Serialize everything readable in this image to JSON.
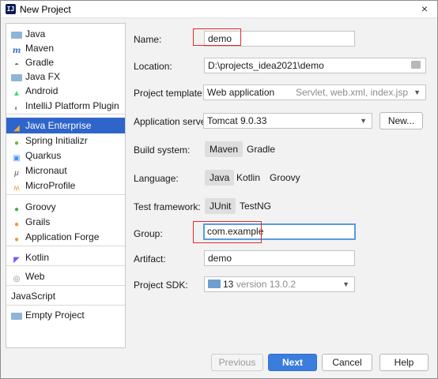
{
  "window": {
    "title": "New Project",
    "close_symbol": "×"
  },
  "sidebar": {
    "items": [
      {
        "label": "Java",
        "icon": "folder-icon"
      },
      {
        "label": "Maven",
        "icon": "maven-icon"
      },
      {
        "label": "Gradle",
        "icon": "gradle-icon"
      },
      {
        "label": "Java FX",
        "icon": "folder-icon"
      },
      {
        "label": "Android",
        "icon": "android-icon"
      },
      {
        "label": "IntelliJ Platform Plugin",
        "icon": "plugin-icon"
      },
      {
        "label": "Java Enterprise",
        "icon": "java-enterprise-icon"
      },
      {
        "label": "Spring Initializr",
        "icon": "spring-icon"
      },
      {
        "label": "Quarkus",
        "icon": "quarkus-icon"
      },
      {
        "label": "Micronaut",
        "icon": "micronaut-icon"
      },
      {
        "label": "MicroProfile",
        "icon": "microprofile-icon"
      },
      {
        "label": "Groovy",
        "icon": "groovy-icon"
      },
      {
        "label": "Grails",
        "icon": "grails-icon"
      },
      {
        "label": "Application Forge",
        "icon": "forge-icon"
      },
      {
        "label": "Kotlin",
        "icon": "kotlin-icon"
      },
      {
        "label": "Web",
        "icon": "web-icon"
      },
      {
        "label": "JavaScript",
        "icon": ""
      },
      {
        "label": "Empty Project",
        "icon": "folder-icon"
      }
    ],
    "selected": "Java Enterprise"
  },
  "form": {
    "name": {
      "label": "Name:",
      "value": "demo"
    },
    "location": {
      "label": "Location:",
      "value": "D:\\projects_idea2021\\demo"
    },
    "template": {
      "label": "Project template:",
      "value": "Web application",
      "hint": "Servlet, web.xml, index.jsp"
    },
    "server": {
      "label": "Application server:",
      "value": "Tomcat 9.0.33",
      "new_button": "New..."
    },
    "build": {
      "label": "Build system:",
      "options": [
        "Maven",
        "Gradle"
      ],
      "selected": "Maven"
    },
    "language": {
      "label": "Language:",
      "options": [
        "Java",
        "Kotlin",
        "Groovy"
      ],
      "selected": "Java"
    },
    "test": {
      "label": "Test framework:",
      "options": [
        "JUnit",
        "TestNG"
      ],
      "selected": "JUnit"
    },
    "group": {
      "label": "Group:",
      "value": "com.example"
    },
    "artifact": {
      "label": "Artifact:",
      "value": "demo"
    },
    "sdk": {
      "label": "Project SDK:",
      "version_num": "13",
      "version_text": "version 13.0.2"
    }
  },
  "buttons": {
    "previous": "Previous",
    "next": "Next",
    "cancel": "Cancel",
    "help": "Help"
  },
  "colors": {
    "selection": "#2f65ca",
    "primary_button": "#3b7ddd",
    "highlight_box": "#e02a2a",
    "focus_border": "#5a9ae6"
  }
}
